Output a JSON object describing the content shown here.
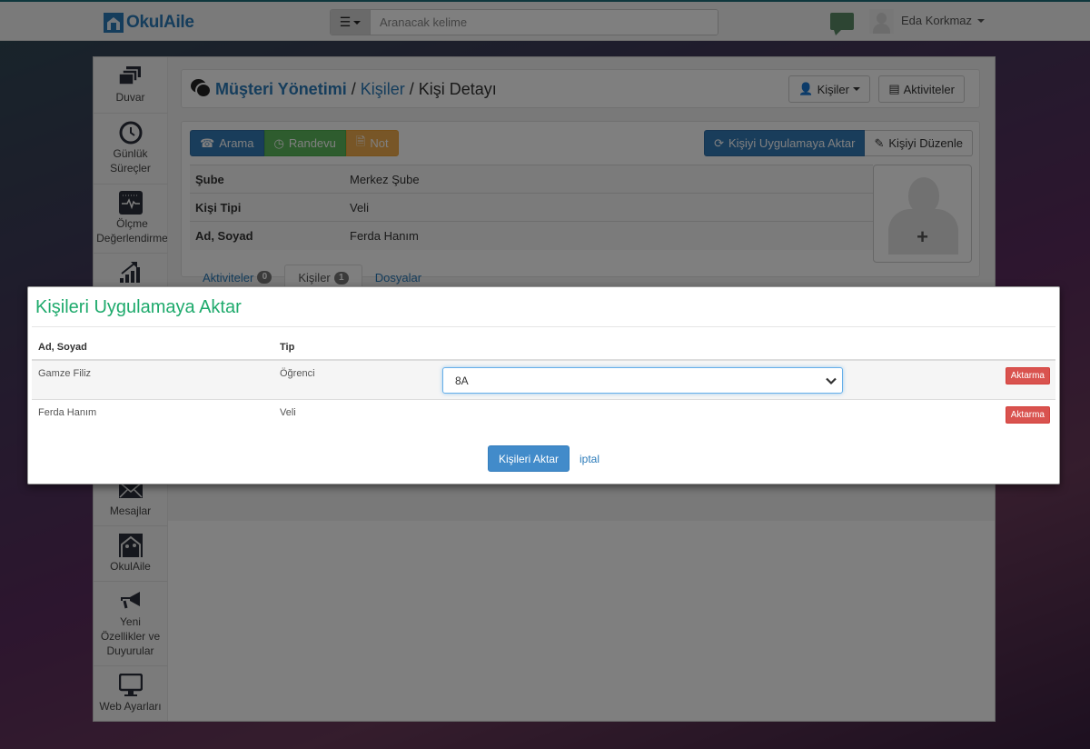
{
  "navbar": {
    "brand": "OkulAile",
    "search_placeholder": "Aranacak kelime",
    "user_name": "Eda Korkmaz"
  },
  "sidebar": {
    "items": [
      {
        "label": "Duvar",
        "icon": "layers-icon"
      },
      {
        "label": "Günlük Süreçler",
        "icon": "clock-icon"
      },
      {
        "label": "Ölçme Değerlendirme",
        "icon": "pulse-chart-icon"
      },
      {
        "label": "",
        "icon": "growth-chart-icon"
      },
      {
        "label": "Mesajlar",
        "icon": "envelope-icon"
      },
      {
        "label": "OkulAile",
        "icon": "okulaile-logo-icon"
      },
      {
        "label": "Yeni Özellikler ve Duyurular",
        "icon": "megaphone-icon"
      },
      {
        "label": "Web Ayarları",
        "icon": "monitor-icon"
      }
    ]
  },
  "header": {
    "title_main": "Müşteri Yönetimi",
    "separator": "/",
    "crumb_link": "Kişiler",
    "crumb_current": "Kişi Detayı",
    "kisiler_button": "Kişiler",
    "aktiviteler_button": "Aktiviteler"
  },
  "detail": {
    "actions": {
      "call": "Arama",
      "appointment": "Randevu",
      "note": "Not",
      "transfer": "Kişiyi Uygulamaya Aktar",
      "edit": "Kişiyi Düzenle"
    },
    "fields": [
      {
        "key": "Şube",
        "value": "Merkez Şube"
      },
      {
        "key": "Kişi Tipi",
        "value": "Veli"
      },
      {
        "key": "Ad, Soyad",
        "value": "Ferda Hanım"
      }
    ],
    "tabs": [
      {
        "label": "Aktiviteler",
        "count": "0",
        "active": false
      },
      {
        "label": "Kişiler",
        "count": "1",
        "active": true
      },
      {
        "label": "Dosyalar",
        "count": null,
        "active": false
      }
    ]
  },
  "modal": {
    "title": "Kişileri Uygulamaya Aktar",
    "columns": {
      "name": "Ad, Soyad",
      "type": "Tip"
    },
    "rows": [
      {
        "name": "Gamze Filiz",
        "type": "Öğrenci",
        "class_select": "8A",
        "action": "Aktarma"
      },
      {
        "name": "Ferda Hanım",
        "type": "Veli",
        "class_select": null,
        "action": "Aktarma"
      }
    ],
    "submit": "Kişileri Aktar",
    "cancel": "iptal"
  },
  "colors": {
    "brand": "#2a7ab9",
    "modal_title": "#1eaa6c",
    "danger": "#d9534f",
    "primary": "#428bca",
    "success": "#5cb85c",
    "warning": "#f0ad4e"
  }
}
